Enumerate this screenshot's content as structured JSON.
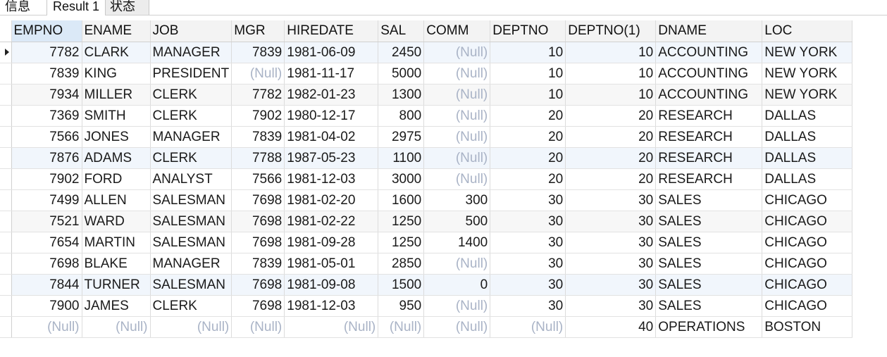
{
  "tabs": [
    {
      "label": "信息"
    },
    {
      "label": "Result 1"
    },
    {
      "label": "状态"
    }
  ],
  "table": {
    "columns": [
      "EMPNO",
      "ENAME",
      "JOB",
      "MGR",
      "HIREDATE",
      "SAL",
      "COMM",
      "DEPTNO",
      "DEPTNO(1)",
      "DNAME",
      "LOC"
    ],
    "rows": [
      [
        "7782",
        "CLARK",
        "MANAGER",
        "7839",
        "1981-06-09",
        "2450",
        "(Null)",
        "10",
        "10",
        "ACCOUNTING",
        "NEW YORK"
      ],
      [
        "7839",
        "KING",
        "PRESIDENT",
        "(Null)",
        "1981-11-17",
        "5000",
        "(Null)",
        "10",
        "10",
        "ACCOUNTING",
        "NEW YORK"
      ],
      [
        "7934",
        "MILLER",
        "CLERK",
        "7782",
        "1982-01-23",
        "1300",
        "(Null)",
        "10",
        "10",
        "ACCOUNTING",
        "NEW YORK"
      ],
      [
        "7369",
        "SMITH",
        "CLERK",
        "7902",
        "1980-12-17",
        "800",
        "(Null)",
        "20",
        "20",
        "RESEARCH",
        "DALLAS"
      ],
      [
        "7566",
        "JONES",
        "MANAGER",
        "7839",
        "1981-04-02",
        "2975",
        "(Null)",
        "20",
        "20",
        "RESEARCH",
        "DALLAS"
      ],
      [
        "7876",
        "ADAMS",
        "CLERK",
        "7788",
        "1987-05-23",
        "1100",
        "(Null)",
        "20",
        "20",
        "RESEARCH",
        "DALLAS"
      ],
      [
        "7902",
        "FORD",
        "ANALYST",
        "7566",
        "1981-12-03",
        "3000",
        "(Null)",
        "20",
        "20",
        "RESEARCH",
        "DALLAS"
      ],
      [
        "7499",
        "ALLEN",
        "SALESMAN",
        "7698",
        "1981-02-20",
        "1600",
        "300",
        "30",
        "30",
        "SALES",
        "CHICAGO"
      ],
      [
        "7521",
        "WARD",
        "SALESMAN",
        "7698",
        "1981-02-22",
        "1250",
        "500",
        "30",
        "30",
        "SALES",
        "CHICAGO"
      ],
      [
        "7654",
        "MARTIN",
        "SALESMAN",
        "7698",
        "1981-09-28",
        "1250",
        "1400",
        "30",
        "30",
        "SALES",
        "CHICAGO"
      ],
      [
        "7698",
        "BLAKE",
        "MANAGER",
        "7839",
        "1981-05-01",
        "2850",
        "(Null)",
        "30",
        "30",
        "SALES",
        "CHICAGO"
      ],
      [
        "7844",
        "TURNER",
        "SALESMAN",
        "7698",
        "1981-09-08",
        "1500",
        "0",
        "30",
        "30",
        "SALES",
        "CHICAGO"
      ],
      [
        "7900",
        "JAMES",
        "CLERK",
        "7698",
        "1981-12-03",
        "950",
        "(Null)",
        "30",
        "30",
        "SALES",
        "CHICAGO"
      ],
      [
        "(Null)",
        "(Null)",
        "(Null)",
        "(Null)",
        "(Null)",
        "(Null)",
        "(Null)",
        "(Null)",
        "40",
        "OPERATIONS",
        "BOSTON"
      ]
    ]
  }
}
